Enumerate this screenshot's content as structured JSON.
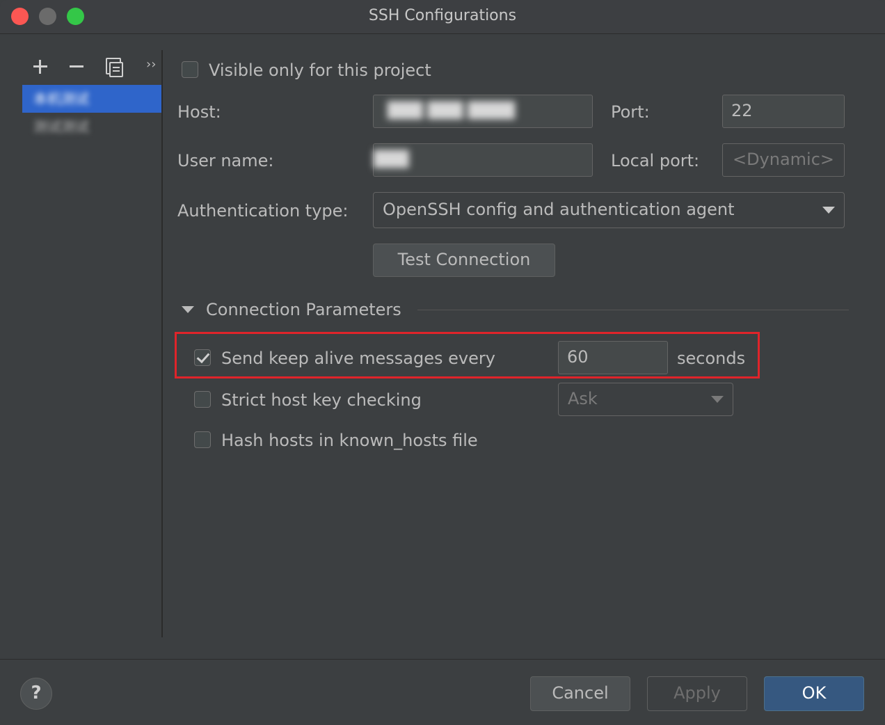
{
  "window": {
    "title": "SSH Configurations"
  },
  "sidebar": {
    "more_glyph": "››",
    "items": [
      {
        "label": "本机测试",
        "selected": true
      },
      {
        "label": "测试测试",
        "selected": false
      }
    ]
  },
  "form": {
    "visible_only_label": "Visible only for this project",
    "visible_only_checked": false,
    "host_label": "Host:",
    "host_value": "███ ███ ████",
    "port_label": "Port:",
    "port_value": "22",
    "username_label": "User name:",
    "username_value": "███",
    "local_port_label": "Local port:",
    "local_port_placeholder": "<Dynamic>",
    "auth_type_label": "Authentication type:",
    "auth_type_value": "OpenSSH config and authentication agent",
    "test_connection_label": "Test Connection"
  },
  "connection_params": {
    "section_title": "Connection Parameters",
    "keep_alive_label": "Send keep alive messages every",
    "keep_alive_checked": true,
    "keep_alive_value": "60",
    "keep_alive_unit": "seconds",
    "strict_host_label": "Strict host key checking",
    "strict_host_checked": false,
    "strict_host_value": "Ask",
    "hash_hosts_label": "Hash hosts in known_hosts file",
    "hash_hosts_checked": false
  },
  "footer": {
    "help_label": "?",
    "cancel_label": "Cancel",
    "apply_label": "Apply",
    "ok_label": "OK"
  },
  "colors": {
    "background": "#3c3f41",
    "selection": "#2f65ca",
    "highlight_border": "#e0242a",
    "primary_button": "#365880"
  }
}
